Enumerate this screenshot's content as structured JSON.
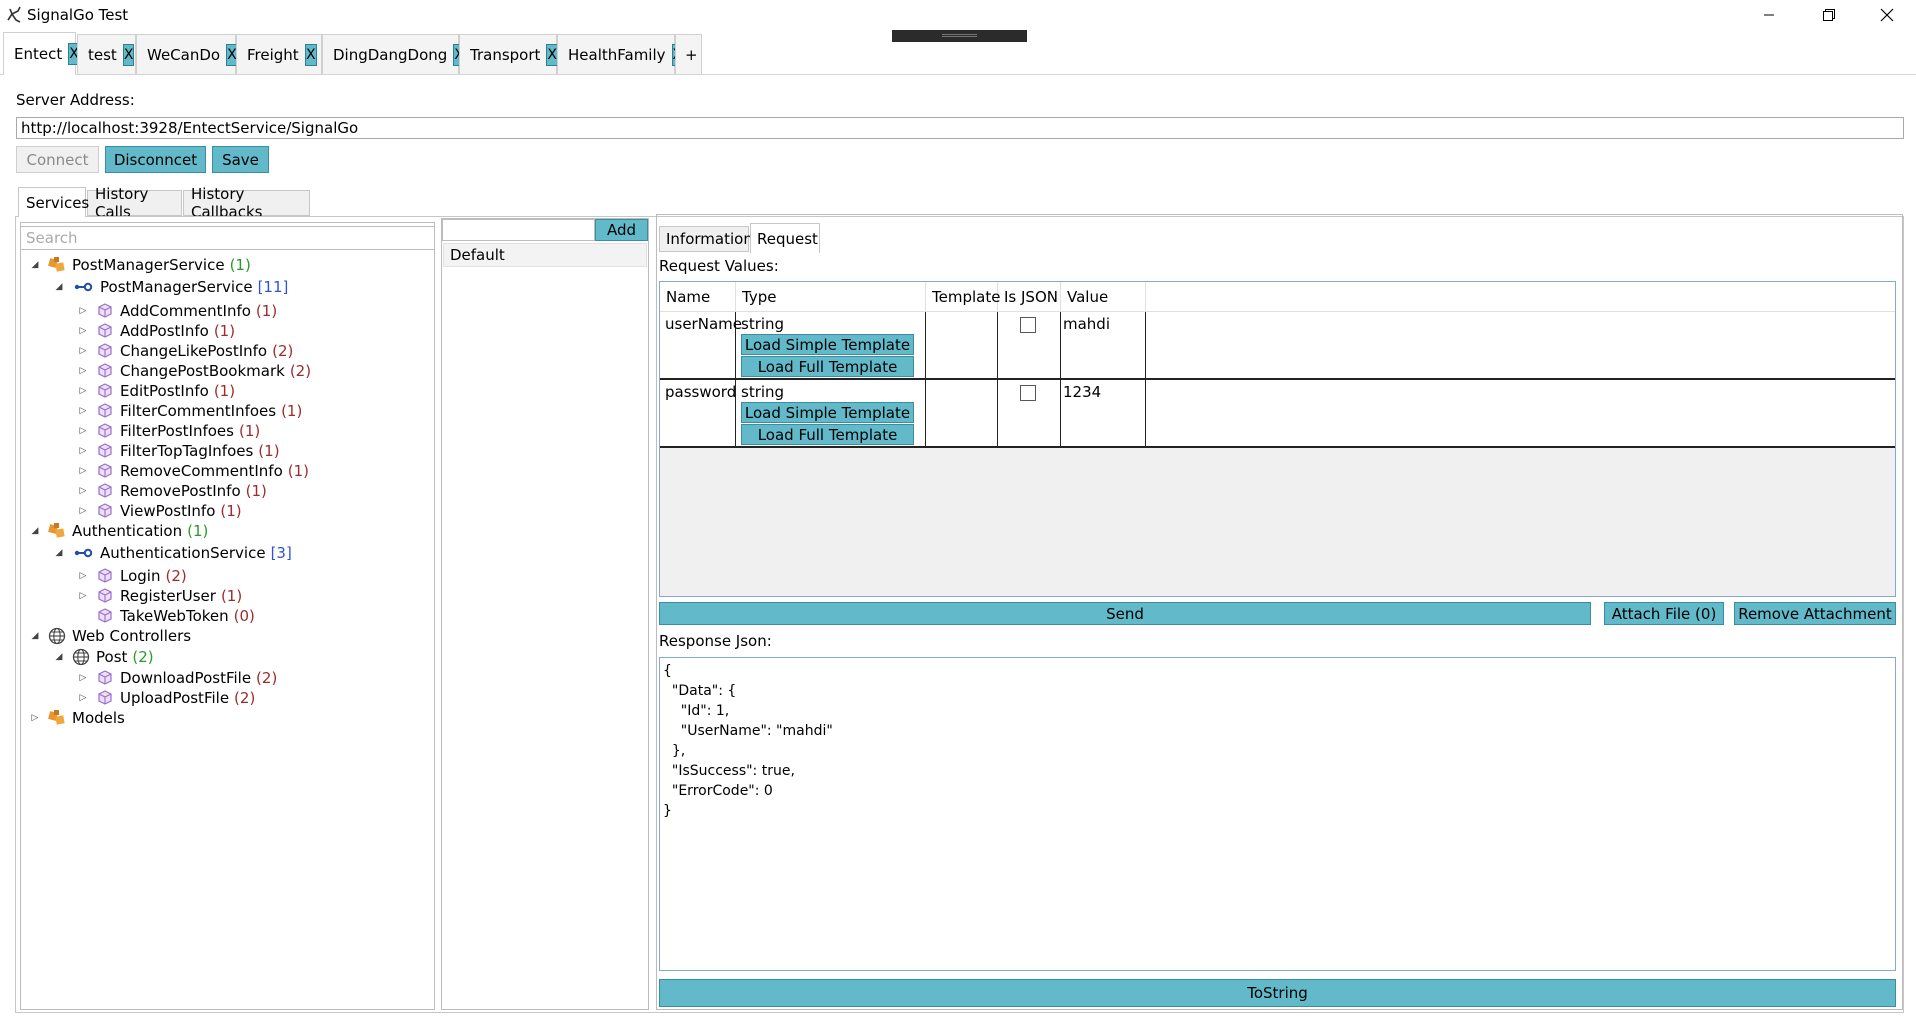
{
  "window": {
    "title": "SignalGo Test"
  },
  "connection_tabs": [
    {
      "label": "Entect",
      "close": "X"
    },
    {
      "label": "test",
      "close": "X"
    },
    {
      "label": "WeCanDo",
      "close": "X"
    },
    {
      "label": "Freight",
      "close": "X"
    },
    {
      "label": "DingDangDong",
      "close": "X"
    },
    {
      "label": "Transport",
      "close": "X"
    },
    {
      "label": "HealthFamily",
      "close": "X"
    }
  ],
  "add_tab_label": "+",
  "server": {
    "label": "Server Address:",
    "value": "http://localhost:3928/EntectService/SignalGo",
    "connect": "Connect",
    "disconnect": "Disconncet",
    "save": "Save"
  },
  "main_tabs": [
    "Services",
    "History Calls",
    "History Callbacks"
  ],
  "search": {
    "placeholder": "Search"
  },
  "tree": [
    {
      "label": "PostManagerService",
      "count": "(1)"
    },
    {
      "label": "PostManagerService",
      "count": "[11]"
    },
    {
      "label": "AddCommentInfo",
      "count": "(1)"
    },
    {
      "label": "AddPostInfo",
      "count": "(1)"
    },
    {
      "label": "ChangeLikePostInfo",
      "count": "(2)"
    },
    {
      "label": "ChangePostBookmark",
      "count": "(2)"
    },
    {
      "label": "EditPostInfo",
      "count": "(1)"
    },
    {
      "label": "FilterCommentInfoes",
      "count": "(1)"
    },
    {
      "label": "FilterPostInfoes",
      "count": "(1)"
    },
    {
      "label": "FilterTopTagInfoes",
      "count": "(1)"
    },
    {
      "label": "RemoveCommentInfo",
      "count": "(1)"
    },
    {
      "label": "RemovePostInfo",
      "count": "(1)"
    },
    {
      "label": "ViewPostInfo",
      "count": "(1)"
    },
    {
      "label": "Authentication",
      "count": "(1)"
    },
    {
      "label": "AuthenticationService",
      "count": "[3]"
    },
    {
      "label": "Login",
      "count": "(2)"
    },
    {
      "label": "RegisterUser",
      "count": "(1)"
    },
    {
      "label": "TakeWebToken",
      "count": "(0)"
    },
    {
      "label": "Web Controllers",
      "count": ""
    },
    {
      "label": "Post",
      "count": "(2)"
    },
    {
      "label": "DownloadPostFile",
      "count": "(2)"
    },
    {
      "label": "UploadPostFile",
      "count": "(2)"
    },
    {
      "label": "Models",
      "count": ""
    }
  ],
  "middle": {
    "input_value": "",
    "add_button": "Add",
    "items": [
      "Default"
    ]
  },
  "sub_tabs": [
    "Information",
    "Request"
  ],
  "request": {
    "values_label": "Request Values:",
    "columns": [
      "Name",
      "Type",
      "Template",
      "Is JSON",
      "Value"
    ],
    "rows": [
      {
        "name": "userName",
        "type": "string",
        "simple_btn": "Load Simple Template",
        "full_btn": "Load Full Template",
        "template": "",
        "value": "mahdi"
      },
      {
        "name": "password",
        "type": "string",
        "simple_btn": "Load Simple Template",
        "full_btn": "Load Full Template",
        "template": "",
        "value": "1234"
      }
    ],
    "send": "Send",
    "attach": "Attach File (0)",
    "remove_attachment": "Remove Attachment"
  },
  "response": {
    "label": "Response Json:",
    "json": "{\n  \"Data\": {\n    \"Id\": 1,\n    \"UserName\": \"mahdi\"\n  },\n  \"IsSuccess\": true,\n  \"ErrorCode\": 0\n}",
    "tostring": "ToString"
  },
  "colors": {
    "accent": "#62b9c9",
    "accent_border": "#3b8e9d",
    "count_green": "#2b9a2b",
    "count_blue": "#2e54d6",
    "count_red": "#9d2d2d",
    "service_orange": "#e8962e"
  }
}
